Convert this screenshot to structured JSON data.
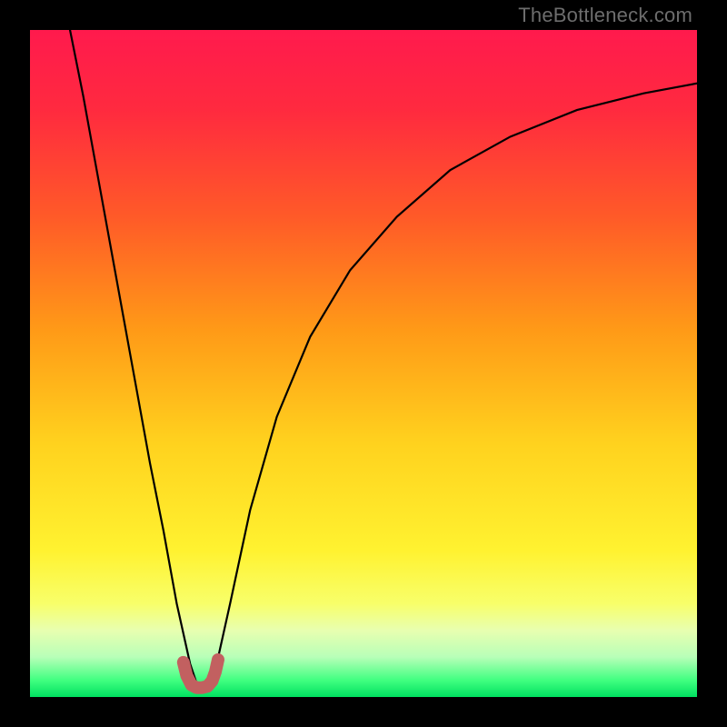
{
  "watermark": "TheBottleneck.com",
  "gradient_stops": [
    {
      "offset": 0.0,
      "color": "#ff1a4d"
    },
    {
      "offset": 0.12,
      "color": "#ff2a3f"
    },
    {
      "offset": 0.28,
      "color": "#ff5a28"
    },
    {
      "offset": 0.45,
      "color": "#ff9a17"
    },
    {
      "offset": 0.62,
      "color": "#ffd21e"
    },
    {
      "offset": 0.78,
      "color": "#fff230"
    },
    {
      "offset": 0.86,
      "color": "#f8ff6a"
    },
    {
      "offset": 0.9,
      "color": "#e8ffb0"
    },
    {
      "offset": 0.94,
      "color": "#b8ffb8"
    },
    {
      "offset": 0.975,
      "color": "#40ff80"
    },
    {
      "offset": 1.0,
      "color": "#00e060"
    }
  ],
  "chart_data": {
    "type": "line",
    "title": "",
    "xlabel": "",
    "ylabel": "",
    "xlim": [
      0,
      100
    ],
    "ylim": [
      0,
      100
    ],
    "categories_note": "x is an implicit 0–100 axis (no tick labels shown)",
    "series": [
      {
        "name": "bottleneck-curve",
        "x": [
          6,
          8,
          10,
          12,
          14,
          16,
          18,
          20,
          22,
          24,
          25,
          26,
          27,
          28,
          30,
          33,
          37,
          42,
          48,
          55,
          63,
          72,
          82,
          92,
          100
        ],
        "values": [
          100,
          90,
          79,
          68,
          57,
          46,
          35,
          25,
          14,
          5,
          2,
          1.5,
          2,
          5,
          14,
          28,
          42,
          54,
          64,
          72,
          79,
          84,
          88,
          90.5,
          92
        ]
      },
      {
        "name": "trough-marker",
        "x": [
          23.0,
          23.5,
          24.2,
          25.0,
          25.8,
          26.6,
          27.3,
          27.8,
          28.2
        ],
        "values": [
          5.2,
          3.2,
          1.8,
          1.4,
          1.4,
          1.6,
          2.4,
          3.8,
          5.6
        ]
      }
    ],
    "legend": null,
    "grid": false,
    "marker_color": "#c26060",
    "curve_color": "#000000"
  }
}
